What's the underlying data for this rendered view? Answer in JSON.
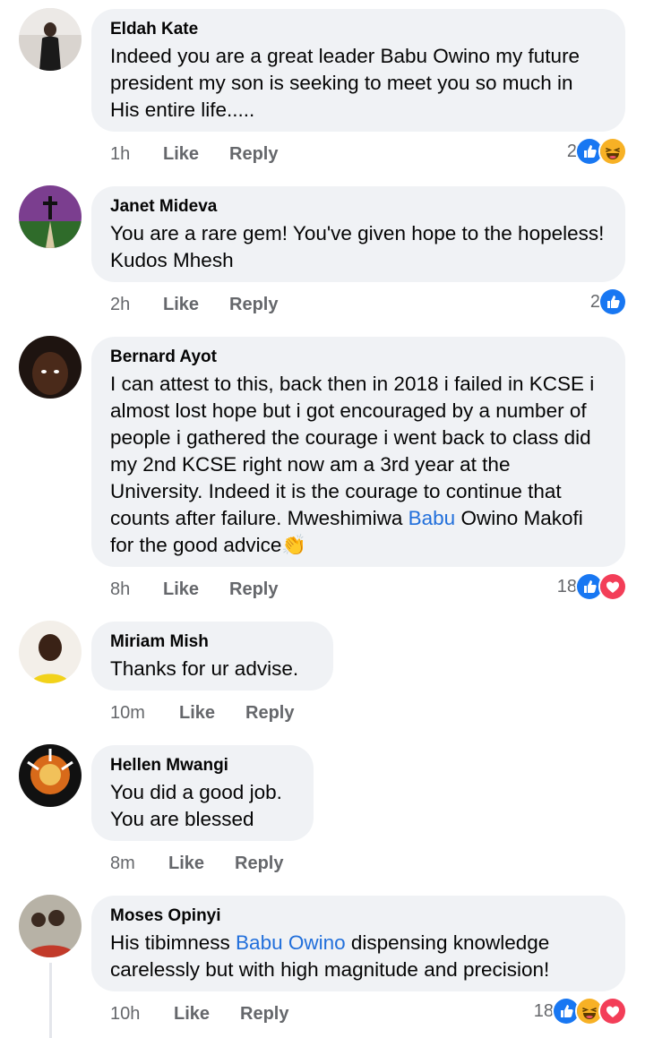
{
  "comments": [
    {
      "author": "Eldah Kate",
      "text_parts": [
        "Indeed you are a great leader Babu Owino my future president my son is seeking to meet you so much in His entire life....."
      ],
      "time": "1h",
      "like_label": "Like",
      "reply_label": "Reply",
      "reaction_count": "2",
      "reactions": [
        "like-reaction-icon",
        "haha-reaction-icon"
      ]
    },
    {
      "author": "Janet Mideva",
      "text_parts": [
        "You are a rare gem! You've given hope to the hopeless! Kudos Mhesh"
      ],
      "time": "2h",
      "like_label": "Like",
      "reply_label": "Reply",
      "reaction_count": "2",
      "reactions": [
        "like-reaction-icon"
      ]
    },
    {
      "author": "Bernard Ayot",
      "text_parts": [
        "I can attest to this, back then in 2018 i failed in KCSE i almost lost hope but i got encouraged by a number of people i gathered the courage i went back to class did my 2nd KCSE right now am a 3rd year at the University. Indeed it is the courage to continue that counts after failure. Mweshimiwa ",
        "Babu",
        " Owino Makofi for the good advice",
        "👏"
      ],
      "time": "8h",
      "like_label": "Like",
      "reply_label": "Reply",
      "reaction_count": "18",
      "reactions": [
        "like-reaction-icon",
        "love-reaction-icon"
      ]
    },
    {
      "author": "Miriam Mish",
      "text_parts": [
        "Thanks for ur advise."
      ],
      "time": "10m",
      "like_label": "Like",
      "reply_label": "Reply"
    },
    {
      "author": "Hellen Mwangi",
      "text_parts": [
        "You did a good job.",
        "You are blessed"
      ],
      "time": "8m",
      "like_label": "Like",
      "reply_label": "Reply"
    },
    {
      "author": "Moses Opinyi",
      "text_parts": [
        "His tibimness ",
        "Babu Owino",
        " dispensing knowledge carelessly but with high magnitude and precision!"
      ],
      "time": "10h",
      "like_label": "Like",
      "reply_label": "Reply",
      "reaction_count": "18",
      "reactions": [
        "like-reaction-icon",
        "haha-reaction-icon",
        "love-reaction-icon"
      ]
    }
  ],
  "colors": {
    "bubble": "#f0f2f5",
    "meta_text": "#65676b",
    "mention": "#216fdb",
    "like_reaction": "#1877f2",
    "love_reaction": "#f33e58",
    "haha_reaction": "#f7b125"
  }
}
